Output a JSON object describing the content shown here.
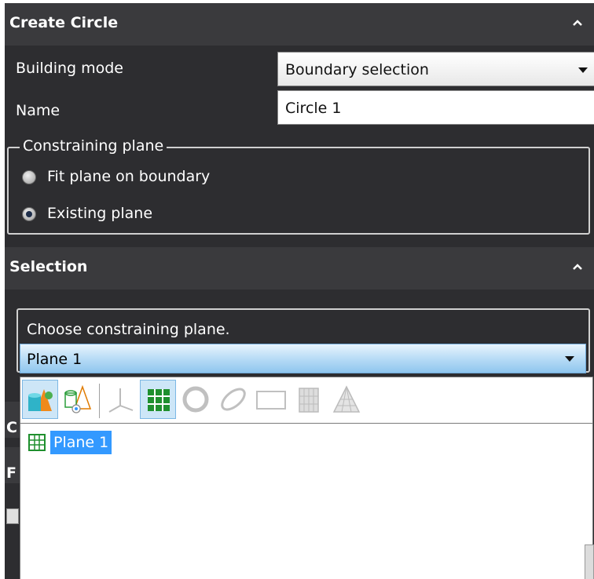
{
  "create_circle": {
    "title": "Create Circle",
    "building_mode_label": "Building mode",
    "building_mode_value": "Boundary selection",
    "name_label": "Name",
    "name_value": "Circle 1",
    "constraining_plane": {
      "legend": "Constraining plane",
      "options": [
        {
          "label": "Fit plane on boundary",
          "checked": false
        },
        {
          "label": "Existing plane",
          "checked": true
        }
      ]
    }
  },
  "selection": {
    "title": "Selection",
    "prompt": "Choose constraining plane.",
    "combo_value": "Plane 1",
    "toolbar_icons": [
      "all-entities-icon",
      "entity-group-icon",
      "coordinate-system-icon",
      "plane-icon",
      "circle-icon",
      "ellipse-icon",
      "rectangle-icon",
      "cylinder-icon",
      "cone-icon"
    ],
    "list_items": [
      "Plane 1"
    ]
  },
  "colors": {
    "panel_bg": "#2d2d30",
    "header_bg": "#3a3a3d",
    "selection_highlight": "#3399ff"
  }
}
